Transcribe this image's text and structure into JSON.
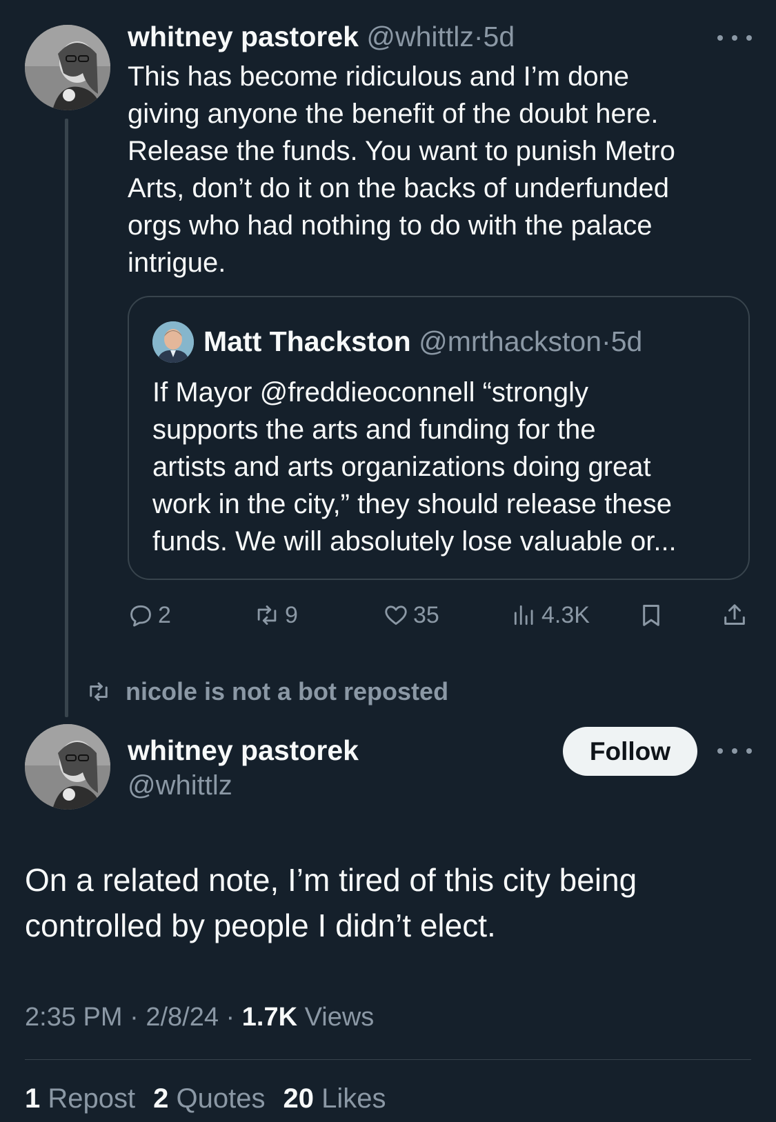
{
  "colors": {
    "background": "#15202b",
    "text_primary": "#f7f9f9",
    "text_secondary": "#8b98a5",
    "border": "#38444d",
    "follow_button_bg": "#eff3f4"
  },
  "tweet1": {
    "author_name": "whitney pastorek",
    "author_handle": "@whittlz",
    "time_separator": "·",
    "time": "5d",
    "body_lines": [
      "This has become ridiculous and I’m done",
      "giving anyone the benefit of the doubt here.",
      "Release the funds. You want to punish Metro",
      "Arts, don’t do it on the backs of underfunded",
      "orgs who had nothing to do with the palace",
      "intrigue."
    ],
    "quote": {
      "author_name": "Matt Thackston",
      "author_handle": "@mrthackston",
      "time_separator": "·",
      "time": "5d",
      "body_lines": [
        "If Mayor @freddieoconnell “strongly",
        "supports the arts and funding for the",
        "artists and arts organizations doing great",
        "work in the city,” they should release these",
        "funds. We will absolutely lose valuable or..."
      ]
    },
    "actions": {
      "replies": "2",
      "reposts": "9",
      "likes": "35",
      "views": "4.3K",
      "icons": [
        "reply-icon",
        "repost-icon",
        "like-icon",
        "views-icon",
        "bookmark-icon",
        "share-icon"
      ]
    }
  },
  "repost_banner": {
    "text": "nicole is not a bot reposted",
    "icon": "repost-icon"
  },
  "tweet2": {
    "author_name": "whitney pastorek",
    "author_handle": "@whittlz",
    "follow_label": "Follow",
    "body_lines": [
      "On a related note, I’m tired of this city being",
      "controlled by people I didn’t elect."
    ],
    "time": "2:35 PM",
    "sep1": "·",
    "date": "2/8/24",
    "sep2": "·",
    "views_count": "1.7K",
    "views_label": "Views",
    "stats": {
      "reposts_count": "1",
      "reposts_label": "Repost",
      "quotes_count": "2",
      "quotes_label": "Quotes",
      "likes_count": "20",
      "likes_label": "Likes"
    }
  }
}
